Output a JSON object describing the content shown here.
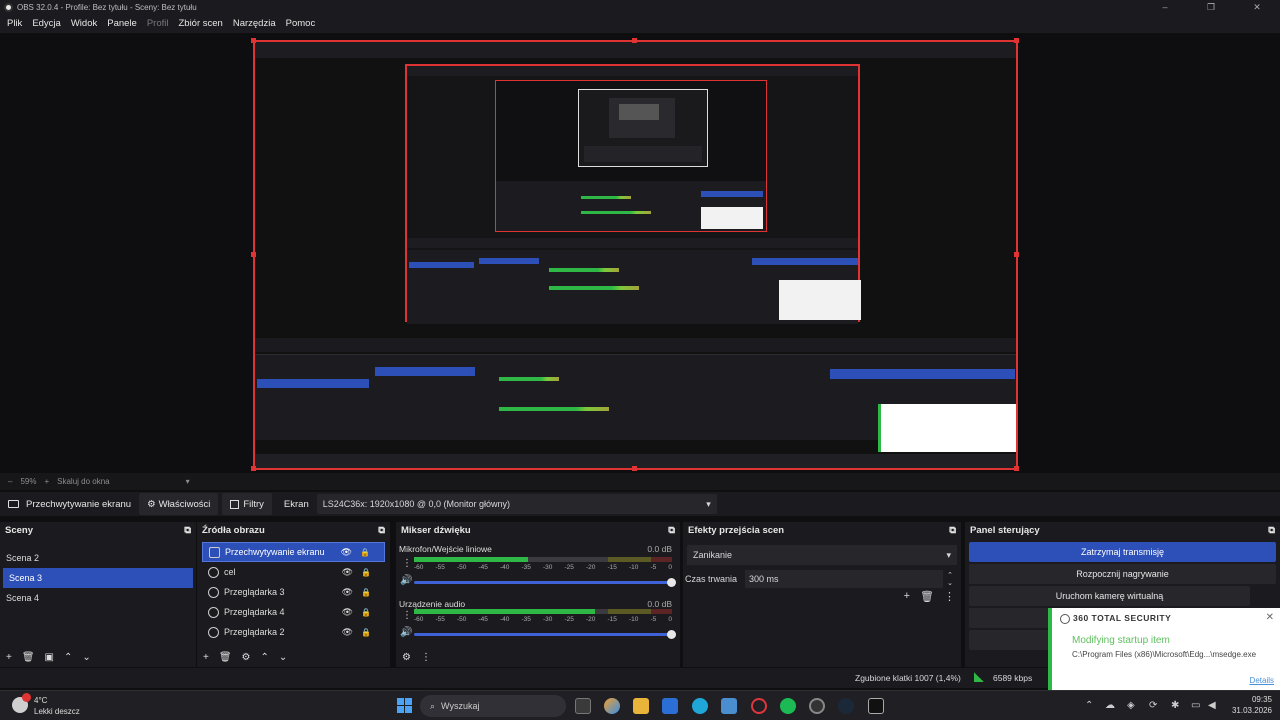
{
  "window": {
    "title": "OBS 32.0.4 - Profile: Bez tytułu - Sceny: Bez tytułu",
    "controls": [
      "–",
      "❐",
      "✕"
    ]
  },
  "menu": {
    "items": [
      "Plik",
      "Edycja",
      "Widok",
      "Panele",
      "Profil",
      "Zbiór scen",
      "Narzędzia",
      "Pomoc"
    ]
  },
  "zoombar": {
    "zoom": "59%",
    "fit": "Skaluj do okna"
  },
  "sourcebar": {
    "source_name": "Przechwytywanie ekranu",
    "properties_label": "Właściwości",
    "filters_label": "Filtry",
    "screen_label": "Ekran",
    "screen_value": "LS24C36x: 1920x1080 @ 0,0 (Monitor główny)"
  },
  "scenes": {
    "title": "Sceny",
    "items": [
      "Scena 2",
      "Scena 3",
      "Scena 4"
    ],
    "active_index": 1
  },
  "sources": {
    "title": "Źródła obrazu",
    "items": [
      "Przechwytywanie ekranu",
      "cel",
      "Przeglądarka 3",
      "Przeglądarka 4",
      "Przeglądarka 2"
    ],
    "active_index": 0
  },
  "mixer": {
    "title": "Mikser dźwięku",
    "channels": [
      {
        "name": "Mikrofon/Wejście liniowe",
        "db": "0.0 dB",
        "level": 0.44
      },
      {
        "name": "Urządzenie audio",
        "db": "0.0 dB",
        "level": 0.7
      }
    ],
    "ticks": [
      "-60",
      "-55",
      "-50",
      "-45",
      "-40",
      "-35",
      "-30",
      "-25",
      "-20",
      "-15",
      "-10",
      "-5",
      "0"
    ]
  },
  "transitions": {
    "title": "Efekty przejścia scen",
    "selected": "Zanikanie",
    "duration_label": "Czas trwania",
    "duration_value": "300 ms"
  },
  "controls": {
    "title": "Panel sterujący",
    "buttons": [
      "Zatrzymaj transmisję",
      "Rozpocznij nagrywanie",
      "Uruchom kamerę wirtualną"
    ]
  },
  "status": {
    "dropped": "Zgubione klatki 1007 (1,4%)",
    "bitrate": "6589 kbps"
  },
  "toast": {
    "brand": "360 TOTAL SECURITY",
    "headline": "Modifying startup item",
    "path": "C:\\Program Files (x86)\\Microsoft\\Edg...\\msedge.exe",
    "link": "Details"
  },
  "taskbar": {
    "weather_temp": "4°C",
    "weather_desc": "Lekki deszcz",
    "search_placeholder": "Wyszukaj",
    "time": "09:35",
    "date": "31.03.2026"
  },
  "colors": {
    "accent": "#2d4fb8",
    "selection_border": "#e03434",
    "meter_green": "#2fb845"
  }
}
